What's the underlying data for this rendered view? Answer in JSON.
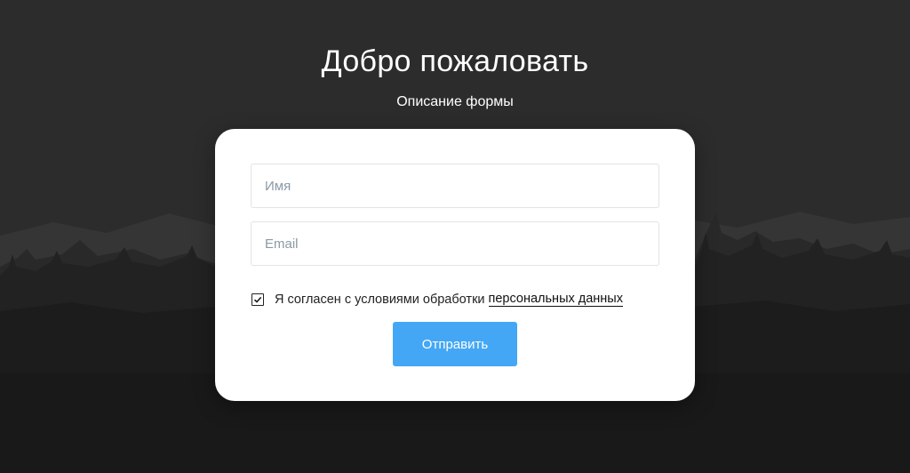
{
  "header": {
    "title": "Добро пожаловать",
    "subtitle": "Описание формы"
  },
  "form": {
    "name_placeholder": "Имя",
    "email_placeholder": "Email",
    "consent_text": "Я согласен с условиями обработки",
    "consent_link": "персональных данных",
    "consent_checked": true,
    "submit_label": "Отправить"
  },
  "theme": {
    "background": "#2c2c2c",
    "card": "#ffffff",
    "accent": "#44a7f5"
  }
}
